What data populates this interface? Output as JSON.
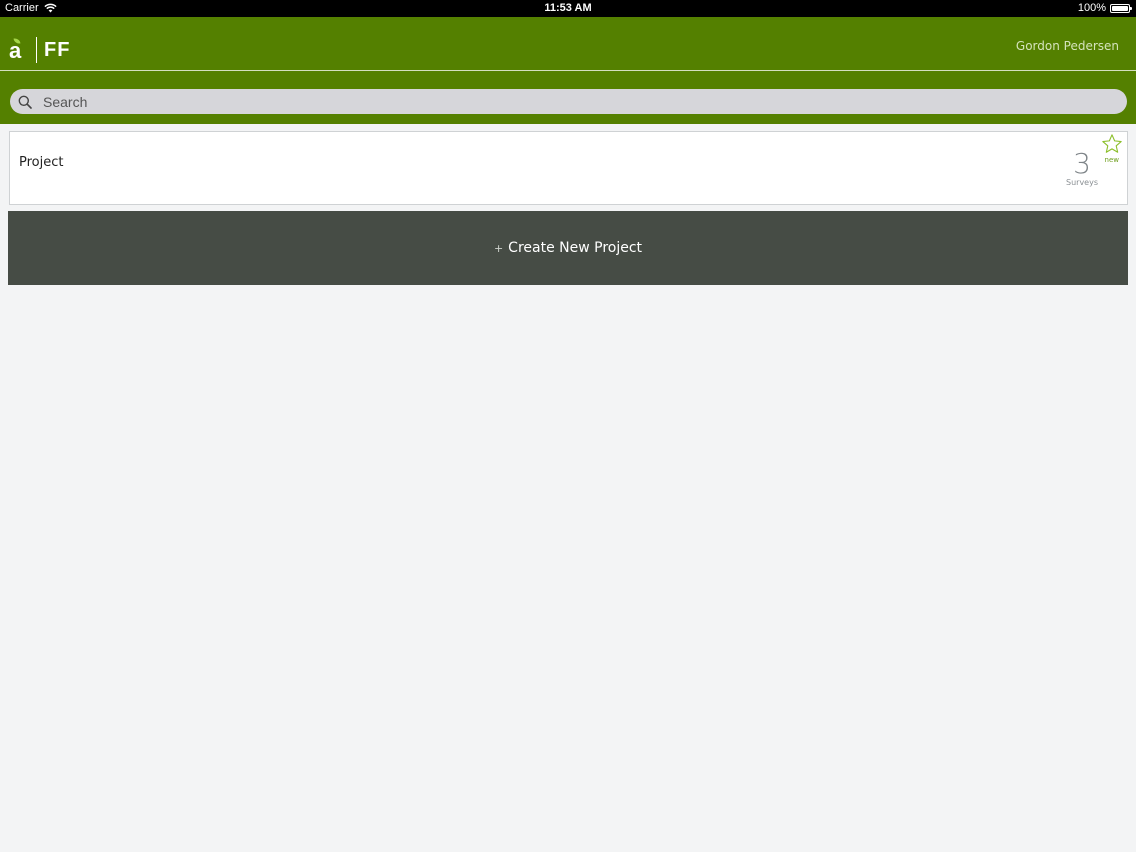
{
  "status_bar": {
    "carrier": "Carrier",
    "time": "11:53 AM",
    "battery_percent": "100%",
    "battery_level": 1.0
  },
  "header": {
    "logo_letter": "a",
    "app_name": "FF",
    "user_name": "Gordon Pedersen",
    "background_color": "#548000"
  },
  "search": {
    "placeholder": "Search",
    "icon": "search-icon"
  },
  "projects": [
    {
      "title": "Project",
      "survey_count": "3",
      "survey_label": "Surveys",
      "badge": "new",
      "badge_icon": "star-icon"
    }
  ],
  "create_button": {
    "plus": "+",
    "label": "Create New Project",
    "background_color": "#464c45"
  }
}
